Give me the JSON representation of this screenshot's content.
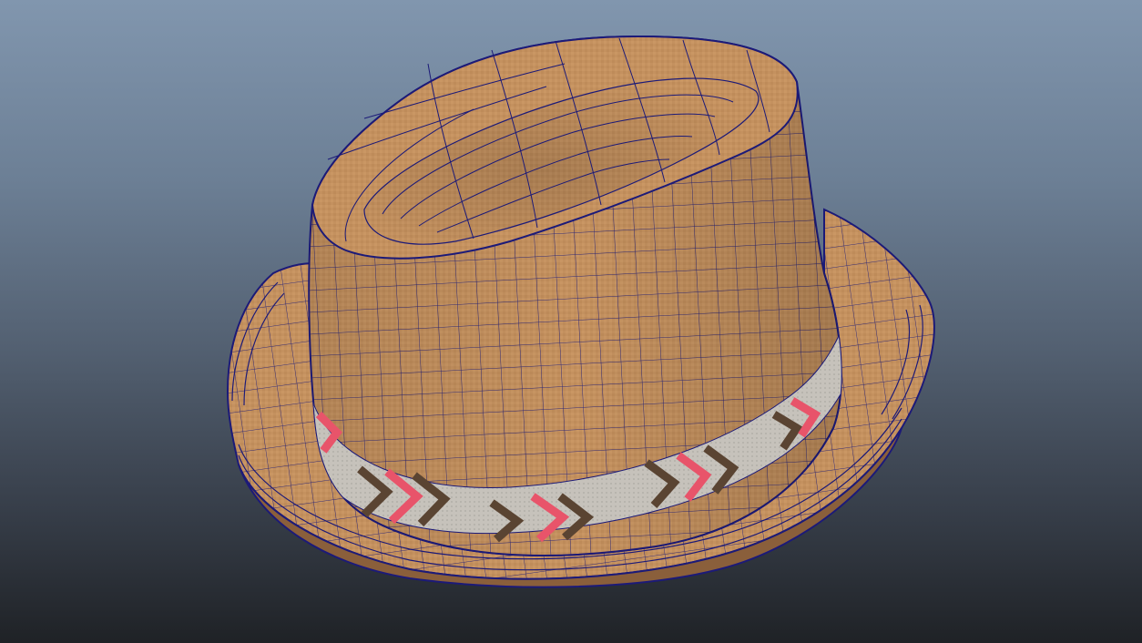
{
  "viewport": {
    "background_top": "#8196ae",
    "background_bottom": "#1f2226"
  },
  "model": {
    "icon": "straw-fedora-hat-wireframe",
    "material_color": "#c4915f",
    "material_shadow": "#9a6c43",
    "wireframe_color": "#1c1a78",
    "band_color": "#c3c0bc",
    "band_accent_red": "#e8546a",
    "band_accent_dark": "#5a4432"
  }
}
